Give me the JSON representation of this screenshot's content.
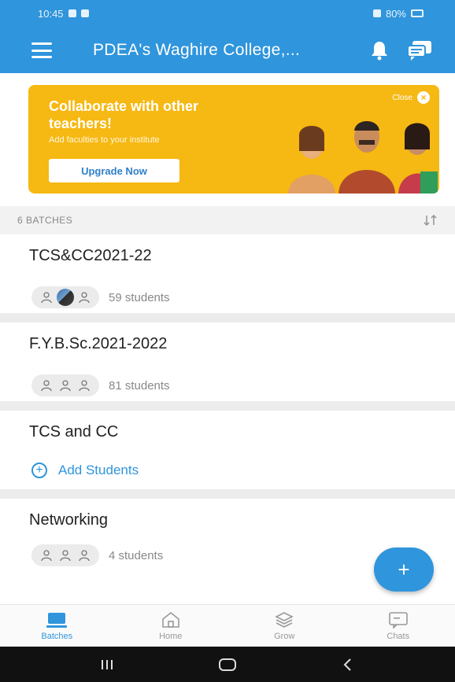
{
  "status": {
    "time": "10:45",
    "battery": "80%"
  },
  "app": {
    "title": "PDEA's Waghire College,..."
  },
  "banner": {
    "title": "Collaborate with other teachers!",
    "subtitle": "Add faculties to your institute",
    "button_label": "Upgrade Now",
    "close_label": "Close"
  },
  "batches": {
    "header": "6 BATCHES",
    "items": [
      {
        "name": "TCS&CC2021-22",
        "count": "59 students",
        "has_photo": true
      },
      {
        "name": "F.Y.B.Sc.2021-2022",
        "count": "81 students",
        "has_photo": false
      },
      {
        "name": "TCS and CC",
        "action": "Add Students"
      },
      {
        "name": "Networking",
        "count": "4 students",
        "has_photo": false
      }
    ]
  },
  "fab": {
    "label": "+"
  },
  "bottom_nav": [
    {
      "label": "Batches",
      "icon": "batches-icon",
      "active": true
    },
    {
      "label": "Home",
      "icon": "home-icon",
      "active": false
    },
    {
      "label": "Grow",
      "icon": "grow-icon",
      "active": false
    },
    {
      "label": "Chats",
      "icon": "chats-icon",
      "active": false
    }
  ],
  "colors": {
    "primary": "#2f95dc",
    "banner": "#f6b812"
  }
}
